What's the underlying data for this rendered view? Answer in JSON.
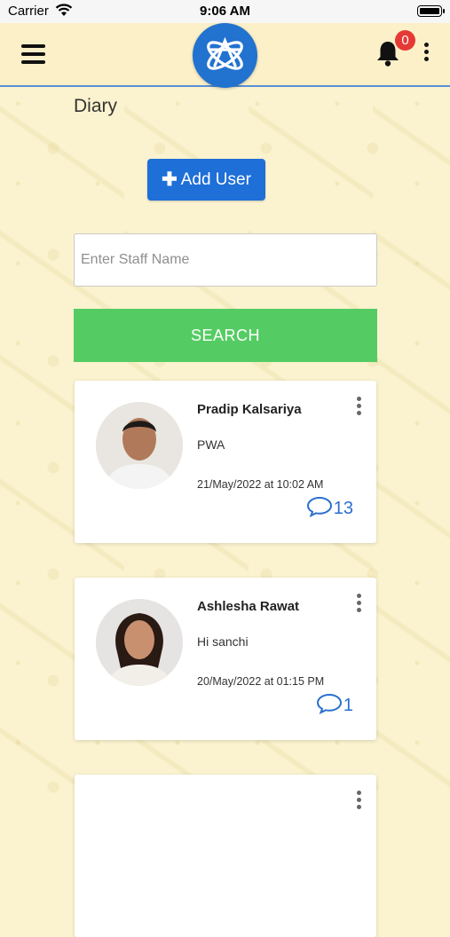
{
  "status_bar": {
    "carrier": "Carrier",
    "time": "9:06 AM"
  },
  "header": {
    "notification_count": "0",
    "icons": [
      "menu-icon",
      "logo",
      "bell-icon",
      "more-vertical-icon"
    ]
  },
  "page": {
    "title": "Diary"
  },
  "actions": {
    "add_user_label": "Add User",
    "search_label": "SEARCH"
  },
  "search": {
    "placeholder": "Enter Staff Name",
    "value": ""
  },
  "entries": [
    {
      "name": "Pradip Kalsariya",
      "message": "PWA",
      "date": "21/May/2022 at 10:02 AM",
      "comments": "13"
    },
    {
      "name": "Ashlesha Rawat",
      "message": "Hi sanchi",
      "date": "20/May/2022 at 01:15 PM",
      "comments": "1"
    }
  ],
  "colors": {
    "header_bg": "#fcf0c8",
    "accent_blue": "#1e6fd8",
    "search_green": "#55cc63",
    "badge_red": "#e53935",
    "comment_blue": "#2a6fcf"
  }
}
